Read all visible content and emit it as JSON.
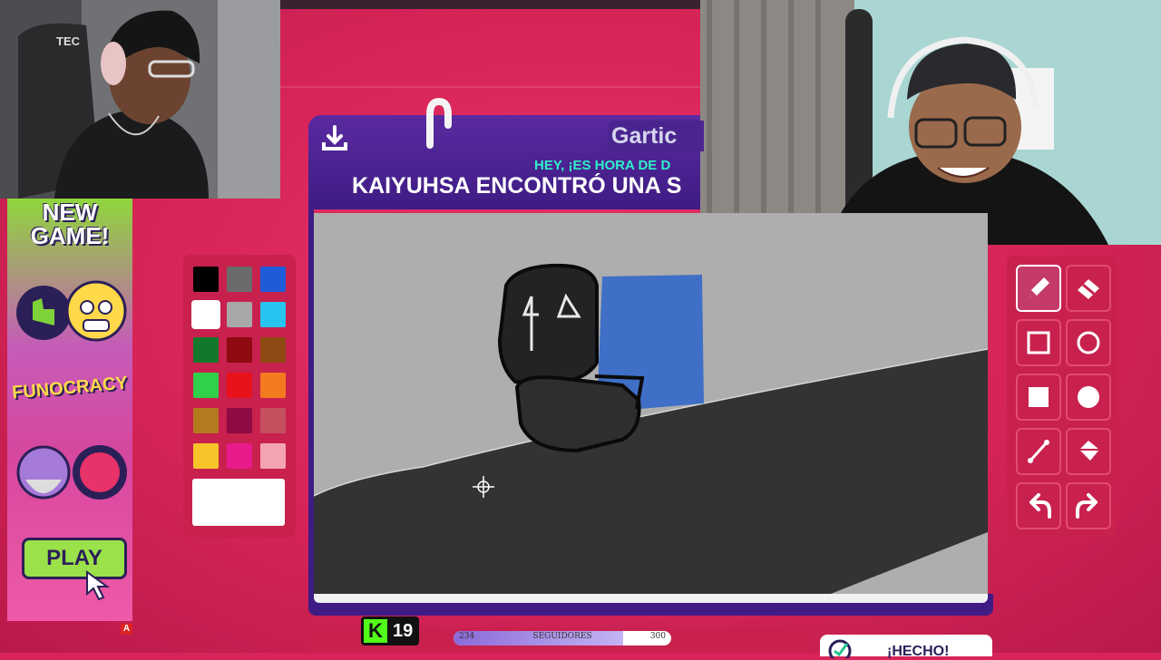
{
  "ad": {
    "title_line1": "NEW",
    "title_line2": "GAME!",
    "brand": "FUNOCRACY",
    "play_label": "PLAY",
    "badge": "A"
  },
  "game": {
    "brand": "Gartic",
    "subtitle": "HEY, ¡ES HORA DE D",
    "headline": "KAIYUHSA ENCONTRÓ UNA S",
    "done_label": "¡HECHO!"
  },
  "palette": {
    "colors": [
      "#000000",
      "#6b6b6b",
      "#1e5bd8",
      "#ffffff",
      "#a8a8a8",
      "#28c4f0",
      "#12792a",
      "#8e0a10",
      "#8e4a12",
      "#2fd04a",
      "#e8121c",
      "#f47a20",
      "#b47a1e",
      "#8e0a44",
      "#c65060",
      "#f8c42a",
      "#e81a8c",
      "#f4a4b0"
    ],
    "selected_color": "#ffffff"
  },
  "tools": [
    {
      "name": "pencil-tool",
      "icon": "pencil-icon",
      "active": true
    },
    {
      "name": "eraser-tool",
      "icon": "eraser-icon",
      "active": false
    },
    {
      "name": "rectangle-outline-tool",
      "icon": "square-outline-icon",
      "active": false
    },
    {
      "name": "ellipse-outline-tool",
      "icon": "circle-outline-icon",
      "active": false
    },
    {
      "name": "rectangle-fill-tool",
      "icon": "square-fill-icon",
      "active": false
    },
    {
      "name": "ellipse-fill-tool",
      "icon": "circle-fill-icon",
      "active": false
    },
    {
      "name": "line-tool",
      "icon": "line-icon",
      "active": false
    },
    {
      "name": "fill-bucket-tool",
      "icon": "bucket-icon",
      "active": false
    },
    {
      "name": "undo-tool",
      "icon": "undo-icon",
      "active": false
    },
    {
      "name": "redo-tool",
      "icon": "redo-icon",
      "active": false
    }
  ],
  "stream": {
    "kick_viewers": "19",
    "followers_label": "SEGUIDORES",
    "followers_current": "234",
    "followers_goal": "300",
    "followers_progress": 0.78
  },
  "colors": {
    "background": "#d8245a",
    "window": "#3e1c84",
    "accent": "#2ff0c8"
  }
}
